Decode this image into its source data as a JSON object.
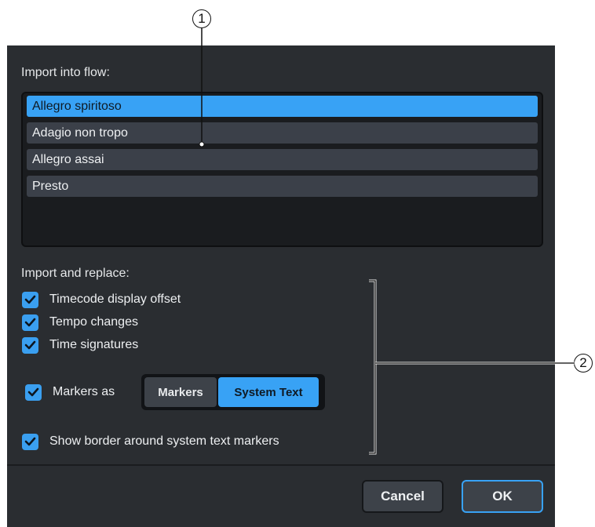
{
  "callouts": {
    "one": "1",
    "two": "2"
  },
  "dialog": {
    "import_into_flow_label": "Import into flow:",
    "flows": [
      {
        "label": "Allegro spiritoso",
        "selected": true
      },
      {
        "label": "Adagio non tropo",
        "selected": false
      },
      {
        "label": "Allegro assai",
        "selected": false
      },
      {
        "label": "Presto",
        "selected": false
      }
    ],
    "import_replace_label": "Import and replace:",
    "options": {
      "timecode": {
        "label": "Timecode display offset",
        "checked": true
      },
      "tempo": {
        "label": "Tempo changes",
        "checked": true
      },
      "time_sig": {
        "label": "Time signatures",
        "checked": true
      },
      "markers_as": {
        "label": "Markers as",
        "checked": true
      },
      "border": {
        "label": "Show border around system text markers",
        "checked": true
      }
    },
    "markers_mode": {
      "options": [
        "Markers",
        "System Text"
      ],
      "selected": "System Text"
    },
    "buttons": {
      "cancel": "Cancel",
      "ok": "OK"
    }
  },
  "colors": {
    "accent": "#38a2f5",
    "dialog_bg": "#2a2d31"
  }
}
